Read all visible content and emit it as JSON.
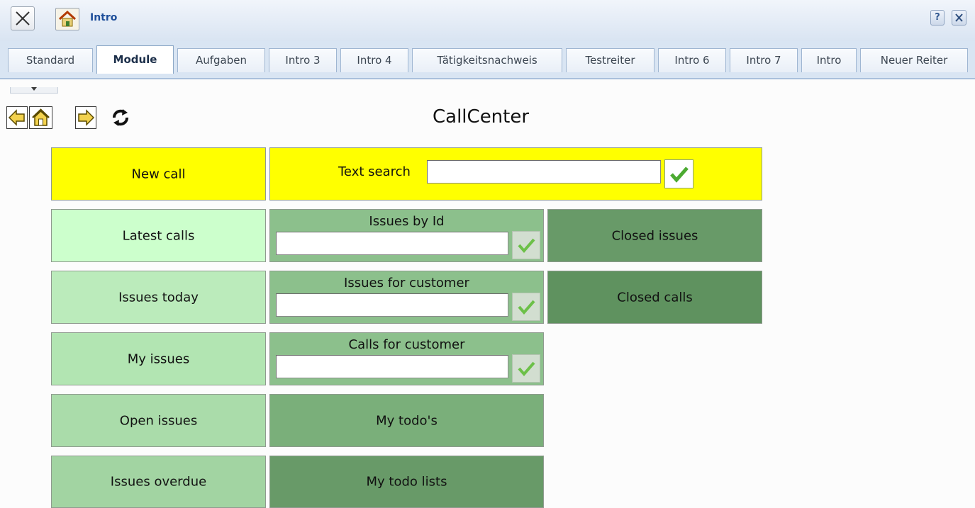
{
  "window": {
    "title": "Intro",
    "help_label": "?"
  },
  "icons": {
    "close": "close-x-icon",
    "home": "home-icon",
    "help": "help-icon",
    "window_close": "close-icon",
    "back": "arrow-left-icon",
    "nav_home": "home-icon",
    "forward": "arrow-right-icon",
    "refresh": "refresh-icon",
    "check": "checkmark-icon",
    "dropdown": "caret-down-icon"
  },
  "tabs": [
    {
      "label": "Standard",
      "active": false
    },
    {
      "label": "Module",
      "active": true
    },
    {
      "label": "Aufgaben",
      "active": false
    },
    {
      "label": "Intro 3",
      "active": false
    },
    {
      "label": "Intro 4",
      "active": false
    },
    {
      "label": "Tätigkeitsnachweis",
      "active": false
    },
    {
      "label": "Testreiter",
      "active": false
    },
    {
      "label": "Intro 6",
      "active": false
    },
    {
      "label": "Intro 7",
      "active": false
    },
    {
      "label": "Intro",
      "active": false
    },
    {
      "label": "Neuer Reiter",
      "active": false
    }
  ],
  "page": {
    "title": "CallCenter"
  },
  "tiles": {
    "new_call": "New call",
    "text_search": {
      "label": "Text search",
      "value": ""
    },
    "latest_calls": "Latest calls",
    "issues_by_id": {
      "label": "Issues by Id",
      "value": ""
    },
    "closed_issues": "Closed issues",
    "issues_today": "Issues today",
    "issues_for_customer": {
      "label": "Issues for customer",
      "value": ""
    },
    "closed_calls": "Closed calls",
    "my_issues": "My issues",
    "calls_for_customer": {
      "label": "Calls for customer",
      "value": ""
    },
    "open_issues": "Open issues",
    "my_todos": "My todo's",
    "issues_overdue": "Issues overdue",
    "my_todo_lists": "My todo lists"
  },
  "colors": {
    "yellow": "#ffff00",
    "light_green_1": "#ccffcc",
    "light_green_2": "#bbebbb",
    "light_green_3": "#b2e5b2",
    "light_green_4": "#aadcaa",
    "mid_green": "#8cc08c",
    "green": "#7aaf7a",
    "dark_green": "#689a68",
    "darker_green": "#5f925f"
  }
}
